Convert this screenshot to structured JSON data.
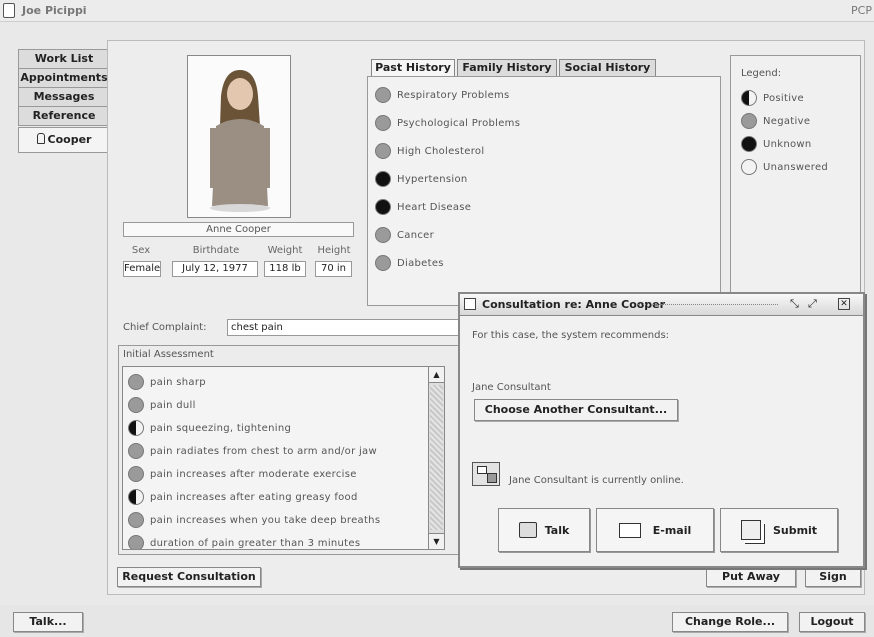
{
  "header": {
    "user_name": "Joe Picippi",
    "role": "PCP"
  },
  "tabs": [
    {
      "label": "Work List"
    },
    {
      "label": "Appointments"
    },
    {
      "label": "Messages"
    },
    {
      "label": "Reference"
    },
    {
      "label": "Cooper"
    }
  ],
  "patient": {
    "name": "Anne Cooper",
    "labels": {
      "sex": "Sex",
      "birthdate": "Birthdate",
      "weight": "Weight",
      "height": "Height"
    },
    "sex": "Female",
    "birthdate": "July 12, 1977",
    "weight": "118 lb",
    "height": "70 in"
  },
  "history": {
    "tabs": [
      "Past History",
      "Family History",
      "Social History"
    ],
    "items": [
      {
        "label": "Respiratory Problems",
        "status": "negative"
      },
      {
        "label": "Psychological Problems",
        "status": "negative"
      },
      {
        "label": "High Cholesterol",
        "status": "negative"
      },
      {
        "label": "Hypertension",
        "status": "unknown"
      },
      {
        "label": "Heart Disease",
        "status": "unknown"
      },
      {
        "label": "Cancer",
        "status": "negative"
      },
      {
        "label": "Diabetes",
        "status": "negative"
      }
    ]
  },
  "legend": {
    "title": "Legend:",
    "items": [
      {
        "label": "Positive",
        "status": "positive"
      },
      {
        "label": "Negative",
        "status": "negative"
      },
      {
        "label": "Unknown",
        "status": "unknown"
      },
      {
        "label": "Unanswered",
        "status": "unanswered"
      }
    ]
  },
  "complaint": {
    "label": "Chief Complaint:",
    "value": "chest pain"
  },
  "assessment": {
    "title": "Initial Assessment",
    "items": [
      {
        "label": "pain sharp",
        "status": "negative"
      },
      {
        "label": "pain dull",
        "status": "negative"
      },
      {
        "label": "pain squeezing, tightening",
        "status": "positive"
      },
      {
        "label": "pain radiates from chest to arm and/or jaw",
        "status": "negative"
      },
      {
        "label": "pain increases after moderate exercise",
        "status": "negative"
      },
      {
        "label": "pain increases after eating greasy food",
        "status": "positive"
      },
      {
        "label": "pain increases when you take deep breaths",
        "status": "negative"
      },
      {
        "label": "duration of pain greater than 3 minutes",
        "status": "negative"
      }
    ]
  },
  "buttons": {
    "request": "Request Consultation",
    "put_away": "Put Away",
    "sign": "Sign",
    "talk": "Talk...",
    "change_role": "Change Role...",
    "logout": "Logout"
  },
  "consultation": {
    "title": "Consultation re: Anne Cooper",
    "recommend": "For this case, the system recommends:",
    "consultant": "Jane Consultant",
    "choose": "Choose Another Consultant...",
    "online": "Jane Consultant is currently online.",
    "talk": "Talk",
    "email": "E-mail",
    "submit": "Submit"
  }
}
